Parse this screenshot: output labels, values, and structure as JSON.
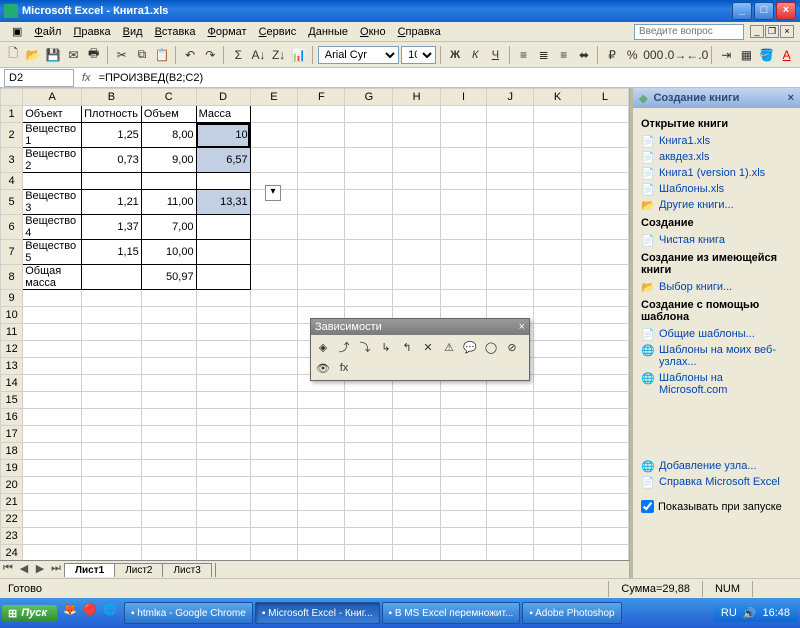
{
  "title": "Microsoft Excel - Книга1.xls",
  "menu": [
    "Файл",
    "Правка",
    "Вид",
    "Вставка",
    "Формат",
    "Сервис",
    "Данные",
    "Окно",
    "Справка"
  ],
  "ask": "Введите вопрос",
  "font": "Arial Cyr",
  "fontsize": "10",
  "cellref": "D2",
  "formula": "=ПРОИЗВЕД(B2;C2)",
  "columns": [
    "A",
    "B",
    "C",
    "D",
    "E",
    "F",
    "G",
    "H",
    "I",
    "J",
    "K",
    "L"
  ],
  "rows": 28,
  "table": {
    "headers": [
      "Объект",
      "Плотность",
      "Объем",
      "Масса"
    ],
    "data": [
      [
        "Вещество 1",
        "1,25",
        "8,00",
        "10"
      ],
      [
        "Вещество 2",
        "0,73",
        "9,00",
        "6,57"
      ],
      [
        "",
        "",
        "",
        ""
      ],
      [
        "Вещество 3",
        "1,21",
        "11,00",
        "13,31"
      ],
      [
        "Вещество 4",
        "1,37",
        "7,00",
        ""
      ],
      [
        "Вещество 5",
        "1,15",
        "10,00",
        ""
      ],
      [
        "Общая масса",
        "",
        "50,97",
        ""
      ]
    ]
  },
  "selected_cells": [
    "D2",
    "D3",
    "D5"
  ],
  "active_cell": "D2",
  "dep_toolbar": "Зависимости",
  "tabs": [
    "Лист1",
    "Лист2",
    "Лист3"
  ],
  "active_tab": 0,
  "taskpane": {
    "title": "Создание книги",
    "sections": {
      "open": {
        "title": "Открытие книги",
        "links": [
          "Книга1.xls",
          "аквдез.xls",
          "Книга1 (version 1).xls",
          "Шаблоны.xls"
        ],
        "more": "Другие книги..."
      },
      "create": {
        "title": "Создание",
        "blank": "Чистая книга"
      },
      "from_existing": {
        "title": "Создание из имеющейся книги",
        "choose": "Выбор книги..."
      },
      "from_template": {
        "title": "Создание с помощью шаблона",
        "links": [
          "Общие шаблоны...",
          "Шаблоны на моих веб-узлах...",
          "Шаблоны на Microsoft.com"
        ]
      }
    },
    "add_node": "Добавление узла...",
    "help": "Справка Microsoft Excel",
    "show_startup": "Показывать при запуске"
  },
  "status": {
    "ready": "Готово",
    "sum": "Сумма=29,88",
    "num": "NUM"
  },
  "taskbar": {
    "start": "Пуск",
    "items": [
      "htmlка - Google Chrome",
      "Microsoft Excel - Книг...",
      "В MS Excel перемножит...",
      "Adobe Photoshop"
    ],
    "active": 1,
    "lang": "RU",
    "time": "16:48"
  }
}
